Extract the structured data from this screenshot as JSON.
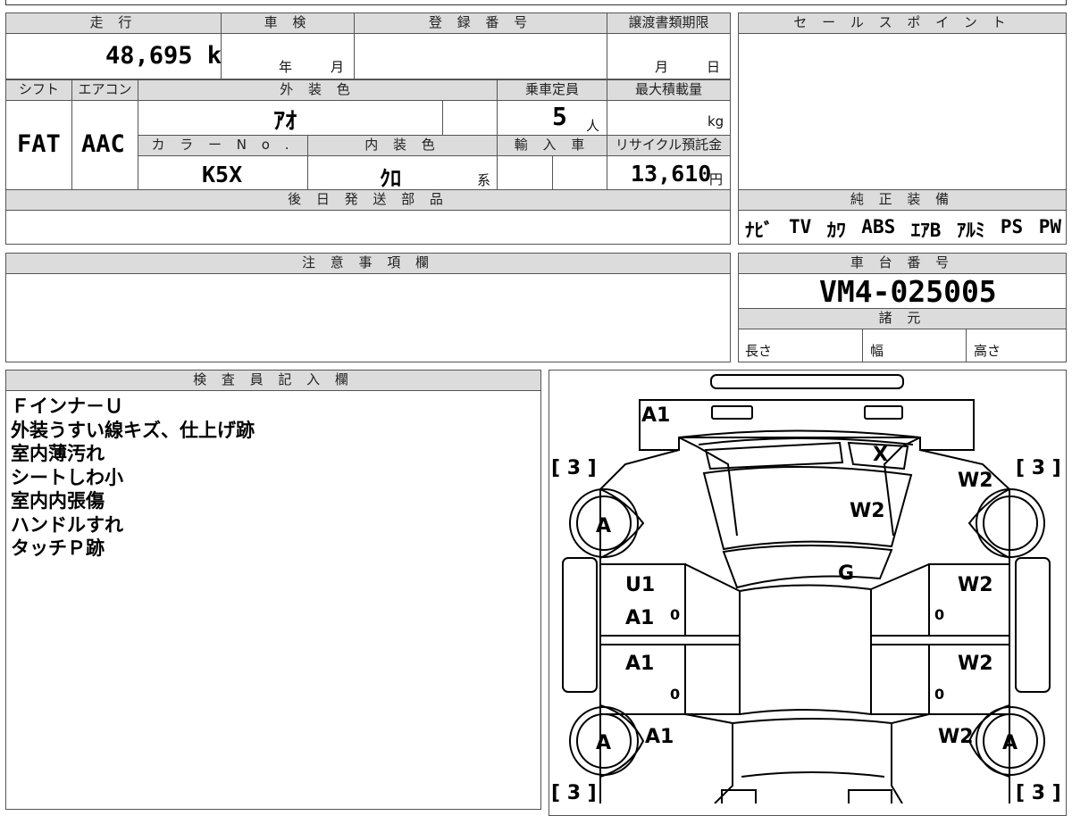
{
  "labels": {
    "mileage": "走 行",
    "inspection": "車 検",
    "registration": "登 録 番 号",
    "transfer_deadline": "譲渡書類期限",
    "sales_point": "セ ー ル ス ポ イ ン ト",
    "shift": "シフト",
    "aircon": "エアコン",
    "exterior_color": "外 装 色",
    "capacity": "乗車定員",
    "max_load": "最大積載量",
    "color_no": "カ ラ ー N o .",
    "interior_color": "内 装 色",
    "import": "輸 入 車",
    "recycle": "リサイクル預託金",
    "later_parts": "後 日 発 送 部 品",
    "genuine_equipment": "純 正 装 備",
    "notes": "注 意 事 項 欄",
    "chassis_no": "車 台 番 号",
    "specs": "諸 元",
    "length": "長さ",
    "width": "幅",
    "height": "高さ",
    "inspector": "検 査 員 記 入 欄"
  },
  "values": {
    "mileage": "48,695 km",
    "year_unit": "年",
    "month_unit": "月",
    "deadline_month": "月",
    "deadline_day": "日",
    "shift": "FAT",
    "aircon": "AAC",
    "exterior_color": "ｱｵ",
    "capacity": "5",
    "capacity_unit": "人",
    "load_unit": "kg",
    "color_no": "K5X",
    "interior_color": "ｸﾛ",
    "interior_suffix": "系",
    "recycle": "13,610",
    "recycle_unit": "円",
    "chassis_no": "VM4-025005"
  },
  "equipment": [
    "ﾅﾋﾞ",
    "TV",
    "ｶﾜ",
    "ABS",
    "ｴｱB",
    "ｱﾙﾐ",
    "PS",
    "PW"
  ],
  "inspector_notes": [
    "Ｆインナ－Ｕ",
    "外装うすい線キズ、仕上げ跡",
    "室内薄汚れ",
    "シートしわ小",
    "室内内張傷",
    "ハンドルすれ",
    "タッチＰ跡"
  ],
  "diagram": {
    "bracket_tl": "[ 3 ]",
    "bracket_tr": "[ 3 ]",
    "bracket_bl": "[ 3 ]",
    "bracket_br": "[ 3 ]",
    "front_bumper": "A1",
    "windshield_corner": "X",
    "windshield": "W2",
    "front_right_glass": "W2",
    "roof": "G",
    "front_door_left_1": "U1",
    "front_door_left_2": "A1",
    "front_door_right": "W2",
    "rear_door_left": "A1",
    "rear_door_right": "W2",
    "rear_left_quarter": "A1",
    "rear_right_quarter": "W2",
    "tire_fl": "A",
    "tire_rl": "A",
    "tire_rr": "A",
    "zero_1": "0",
    "zero_2": "0",
    "zero_3": "0",
    "zero_4": "0"
  }
}
